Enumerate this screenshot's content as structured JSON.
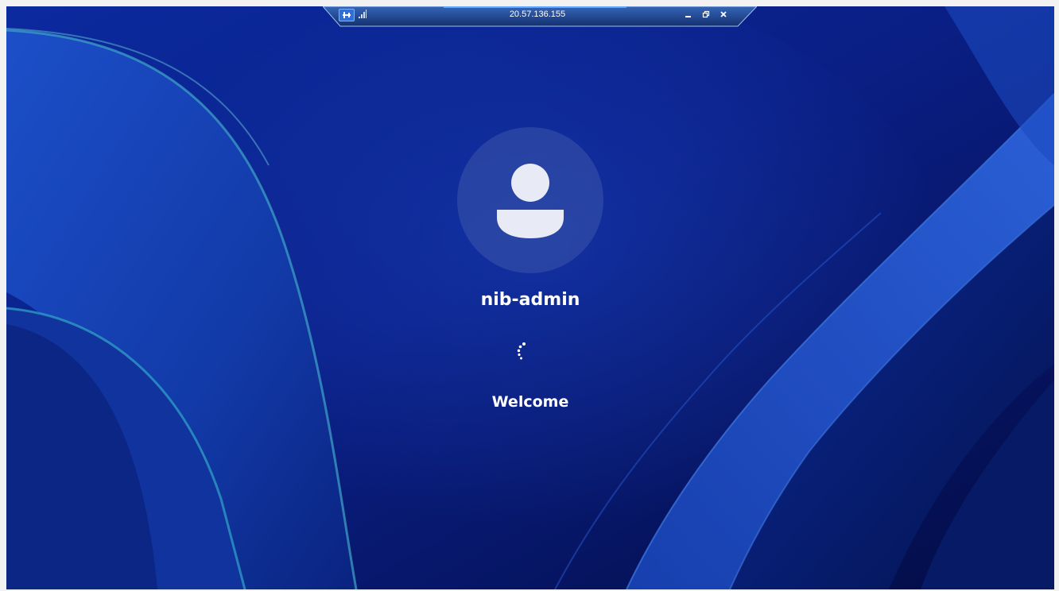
{
  "connection_bar": {
    "title": "20.57.136.155",
    "pin_icon": "pin-icon",
    "signal_icon": "connection-quality-icon",
    "minimize_icon": "minimize-icon",
    "restore_icon": "restore-icon",
    "close_icon": "close-icon"
  },
  "login": {
    "avatar_icon": "user-avatar-icon",
    "username": "nib-admin",
    "spinner_icon": "loading-spinner-icon",
    "status": "Welcome"
  },
  "colors": {
    "background": "#0a1f86",
    "bar": "#1d3f8f",
    "text": "#ffffff"
  }
}
